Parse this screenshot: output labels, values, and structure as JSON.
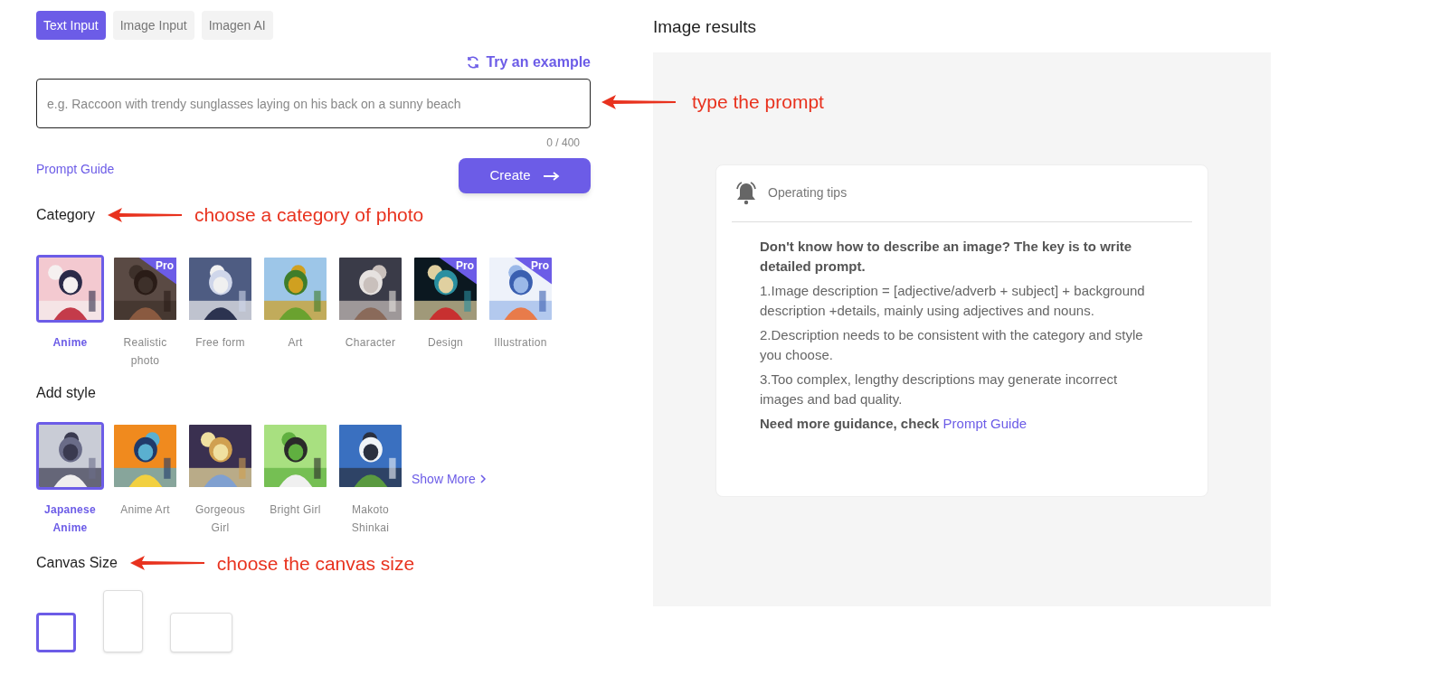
{
  "tabs": [
    {
      "label": "Text Input",
      "selected": true
    },
    {
      "label": "Image Input",
      "selected": false
    },
    {
      "label": "Imagen AI",
      "selected": false
    }
  ],
  "try_example": "Try an example",
  "prompt": {
    "placeholder": "e.g. Raccoon with trendy sunglasses laying on his back on a sunny beach",
    "counter": "0 / 400"
  },
  "prompt_guide": "Prompt Guide",
  "create_button": "Create",
  "category": {
    "title": "Category",
    "items": [
      {
        "label": "Anime",
        "selected": true,
        "kind": "picture"
      },
      {
        "label": "Realistic photo",
        "selected": false,
        "badge": "Pro",
        "kind": "picture"
      },
      {
        "label": "Free form",
        "selected": false,
        "kind": "picture"
      },
      {
        "label": "Art",
        "selected": false,
        "kind": "picture"
      },
      {
        "label": "Character",
        "selected": false,
        "kind": "picture"
      },
      {
        "label": "Design",
        "selected": false,
        "badge": "Pro",
        "kind": "picture"
      },
      {
        "label": "Illustration",
        "selected": false,
        "badge": "Pro",
        "kind": "picture"
      }
    ]
  },
  "style": {
    "title": "Add style",
    "items": [
      {
        "label": "Japanese Anime",
        "selected": true,
        "kind": "picture"
      },
      {
        "label": "Anime Art",
        "selected": false,
        "kind": "picture"
      },
      {
        "label": "Gorgeous Girl",
        "selected": false,
        "kind": "picture"
      },
      {
        "label": "Bright Girl",
        "selected": false,
        "kind": "picture"
      },
      {
        "label": "Makoto Shinkai",
        "selected": false,
        "kind": "picture"
      }
    ],
    "show_more": "Show More"
  },
  "canvas": {
    "title": "Canvas Size",
    "sizes": [
      {
        "kind": "square",
        "selected": true
      },
      {
        "kind": "portrait",
        "selected": false
      },
      {
        "kind": "landscape",
        "selected": false
      }
    ]
  },
  "results": {
    "title": "Image results",
    "tips": {
      "title": "Operating tips",
      "intro": "Don't know how to describe an image? The key is to write detailed prompt.",
      "points": [
        "1.Image description = [adjective/adverb + subject] + background description +details, mainly using adjectives and nouns.",
        "2.Description needs to be consistent with the category and style you choose.",
        "3.Too complex, lengthy descriptions may generate incorrect images and bad quality."
      ],
      "footer": "Need more guidance, check",
      "footer_link": "Prompt Guide"
    }
  },
  "annotations": [
    "type the prompt",
    "choose a category of photo",
    "choose the canvas size"
  ]
}
